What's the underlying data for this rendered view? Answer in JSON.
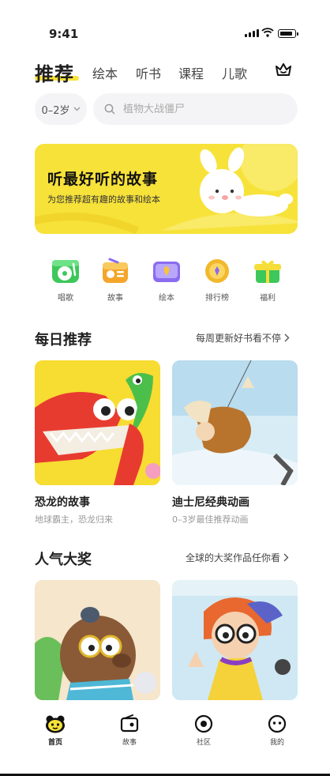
{
  "status": {
    "time": "9:41"
  },
  "tabs": {
    "active": "推荐",
    "items": [
      "绘本",
      "听书",
      "课程",
      "儿歌"
    ]
  },
  "filter": {
    "age": "0–2岁"
  },
  "search": {
    "placeholder": "植物大战僵尸"
  },
  "banner": {
    "title": "听最好听的故事",
    "subtitle": "为您推荐超有趣的故事和绘本"
  },
  "quick_icons": [
    {
      "label": "唱歌",
      "icon": "record-player-icon"
    },
    {
      "label": "故事",
      "icon": "radio-icon"
    },
    {
      "label": "绘本",
      "icon": "book-icon"
    },
    {
      "label": "排行榜",
      "icon": "medal-icon"
    },
    {
      "label": "福利",
      "icon": "gift-icon"
    }
  ],
  "daily": {
    "title": "每日推荐",
    "more": "每周更新好书看不停",
    "cards": [
      {
        "title": "恐龙的故事",
        "subtitle": "地球霸主，恐龙归来"
      },
      {
        "title": "迪士尼经典动画",
        "subtitle": "0–3岁最佳推荐动画"
      }
    ]
  },
  "awards": {
    "title": "人气大奖",
    "more": "全球的大奖作品任你看"
  },
  "bottom_nav": [
    {
      "label": "首页",
      "icon": "home-icon"
    },
    {
      "label": "故事",
      "icon": "story-icon"
    },
    {
      "label": "社区",
      "icon": "community-icon"
    },
    {
      "label": "我的",
      "icon": "profile-icon"
    }
  ],
  "colors": {
    "accent": "#f7e23a",
    "green": "#4cc760",
    "orange": "#f4a52a",
    "purple": "#8a6cf0"
  }
}
